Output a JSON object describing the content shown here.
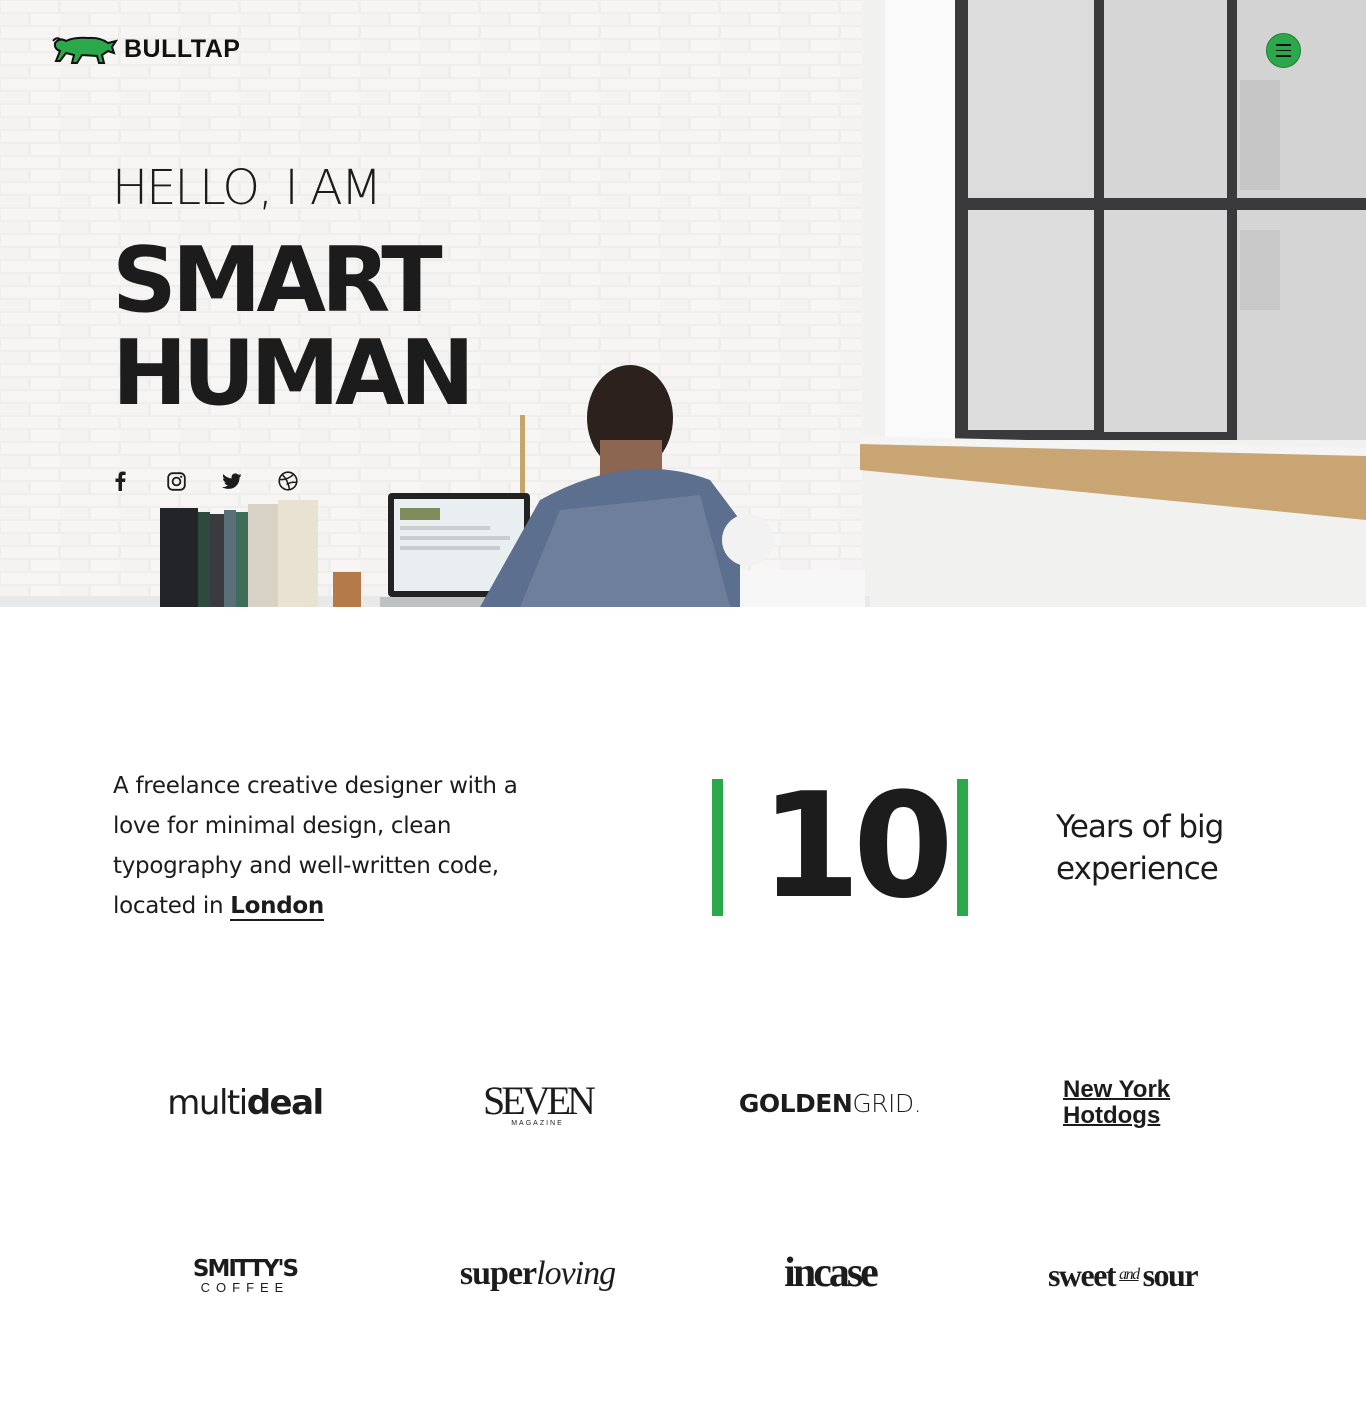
{
  "brand": {
    "name": "BULLTAP",
    "accent": "#2ba84a",
    "text_color": "#1c1c1c"
  },
  "header": {
    "menu_icon": "hamburger-icon"
  },
  "hero": {
    "greeting": "HELLO, I AM",
    "headline_line1": "SMART",
    "headline_line2": "HUMAN",
    "socials": [
      {
        "name": "facebook",
        "icon": "facebook-icon"
      },
      {
        "name": "instagram",
        "icon": "instagram-icon"
      },
      {
        "name": "twitter",
        "icon": "twitter-icon"
      },
      {
        "name": "dribbble",
        "icon": "dribbble-icon"
      }
    ]
  },
  "about": {
    "text": "A freelance creative designer with a love for minimal design, clean typography and well-written code, located in ",
    "location": "London"
  },
  "experience": {
    "number": "10",
    "label": "Years of big experience"
  },
  "clients": {
    "multideal": {
      "part1": "multi",
      "part2": "deal"
    },
    "seven": {
      "main": "SEVEN",
      "sub": "MAGAZINE"
    },
    "goldengrid": {
      "part1": "GOLDEN",
      "part2": "GRID."
    },
    "nyhotdogs": {
      "line1": "New York",
      "line2": "Hotdogs"
    },
    "smittys": {
      "main": "SMITTY'S",
      "sub": "COFFEE"
    },
    "superloving": {
      "part1": "super",
      "part2": "loving"
    },
    "incase": {
      "name": "incase"
    },
    "sweetandsour": {
      "part1": "sweet",
      "part2": "and",
      "part3": "sour"
    }
  }
}
